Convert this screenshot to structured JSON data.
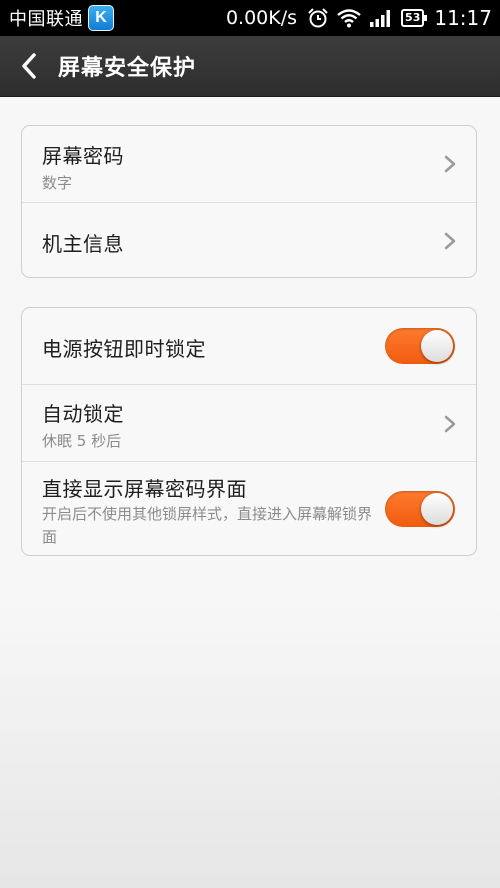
{
  "status_bar": {
    "carrier": "中国联通",
    "app_badge": "K",
    "net_speed": "0.00K/s",
    "battery": "53",
    "time": "11:17"
  },
  "header": {
    "title": "屏幕安全保护"
  },
  "group1": [
    {
      "title": "屏幕密码",
      "subtitle": "数字"
    },
    {
      "title": "机主信息"
    }
  ],
  "group2": [
    {
      "title": "电源按钮即时锁定",
      "toggle_on": true
    },
    {
      "title": "自动锁定",
      "subtitle": "休眠 5 秒后"
    },
    {
      "title": "直接显示屏幕密码界面",
      "subtitle": "开启后不使用其他锁屏样式，直接进入屏幕解锁界面",
      "toggle_on": true
    }
  ],
  "colors": {
    "accent": "#f26a1b",
    "header": "#333333"
  },
  "icons": [
    "back-arrow-icon",
    "alarm-icon",
    "wifi-icon",
    "signal-icon",
    "battery-icon",
    "chevron-right-icon"
  ]
}
